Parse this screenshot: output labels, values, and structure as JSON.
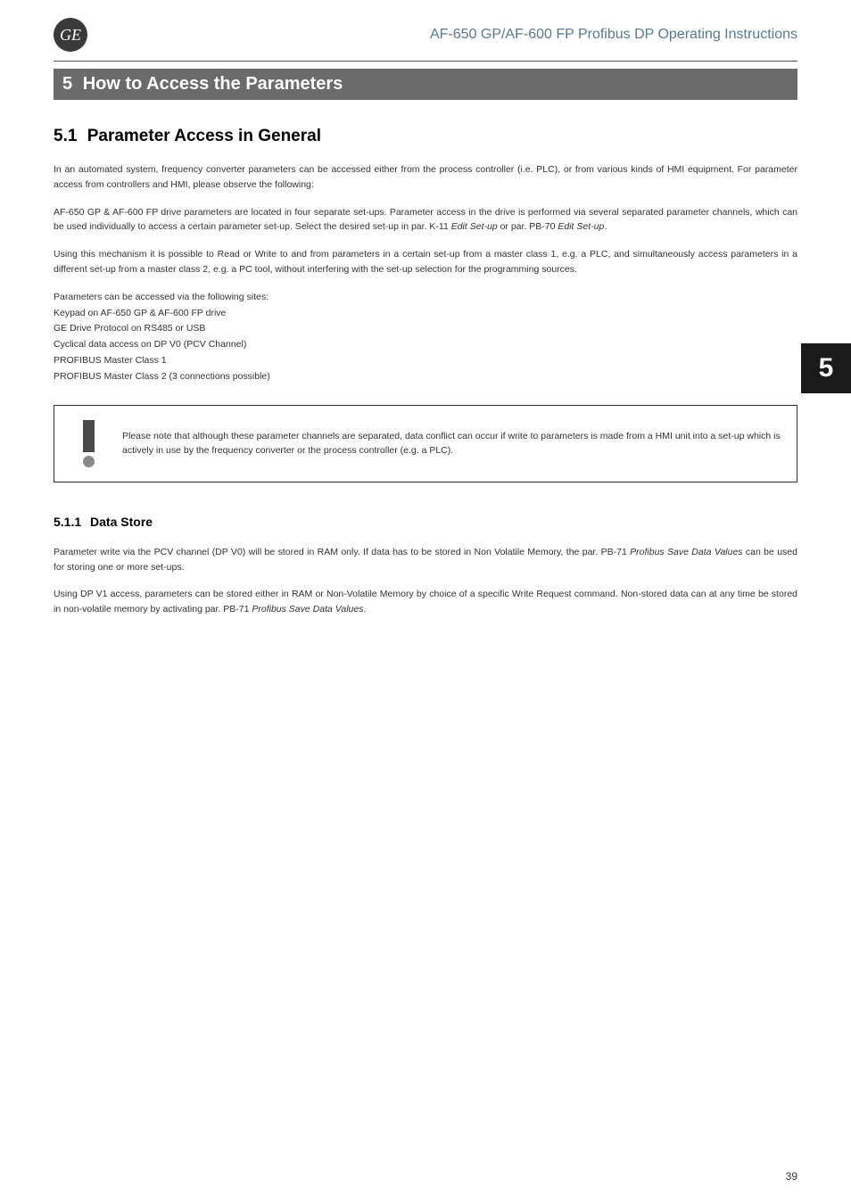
{
  "header": {
    "doc_title": "AF-650 GP/AF-600 FP Profibus DP Operating Instructions",
    "logo_text": "GE"
  },
  "chapter": {
    "number": "5",
    "title": "How to Access the Parameters"
  },
  "side_tab": "5",
  "section": {
    "number": "5.1",
    "title": "Parameter Access in General",
    "para1": "In an automated system, frequency converter parameters can be accessed either from the process controller (i.e. PLC), or from various kinds of HMI equipment. For parameter access from controllers and HMI, please observe the following:",
    "para2_a": "AF-650 GP & AF-600 FP drive parameters are located in four separate set-ups. Parameter access in the drive is performed via several separated parameter channels, which can be used individually to access a certain parameter set-up. Select the desired set-up in par. K-11 ",
    "para2_i1": "Edit Set-up",
    "para2_b": " or par. PB-70 ",
    "para2_i2": "Edit Set-up",
    "para2_c": ".",
    "para3": "Using this mechanism it is possible to Read or Write to and from parameters in a certain set-up from a master class 1, e.g. a PLC, and simultaneously access parameters in a different set-up from a master class 2, e.g. a PC tool, without interfering with the set-up selection for the programming sources.",
    "list_intro": "Parameters can be accessed via the following sites:",
    "list": [
      "Keypad on AF-650 GP & AF-600 FP drive",
      "GE Drive Protocol on RS485 or USB",
      "Cyclical data access on DP V0 (PCV Channel)",
      "PROFIBUS Master Class 1",
      "PROFIBUS Master Class 2 (3 connections possible)"
    ],
    "note": "Please note that although these parameter channels are separated, data conflict can occur if write to parameters is made from a HMI unit into a set-up which is actively in use by the frequency converter or the process controller (e.g. a PLC)."
  },
  "subsection": {
    "number": "5.1.1",
    "title": "Data Store",
    "para1_a": "Parameter write via the PCV channel (DP V0) will be stored in RAM only. If data has to be stored in Non Volatile Memory, the par. PB-71 ",
    "para1_i": "Profibus Save Data Values",
    "para1_b": " can be used for storing one or more set-ups.",
    "para2_a": "Using DP V1 access, parameters can be stored either in RAM or Non-Volatile Memory by choice of a specific Write Request command. Non-stored data can at any time be stored in non-volatile memory by activating par. PB-71 ",
    "para2_i": "Profibus Save Data Values",
    "para2_b": "."
  },
  "page_number": "39"
}
